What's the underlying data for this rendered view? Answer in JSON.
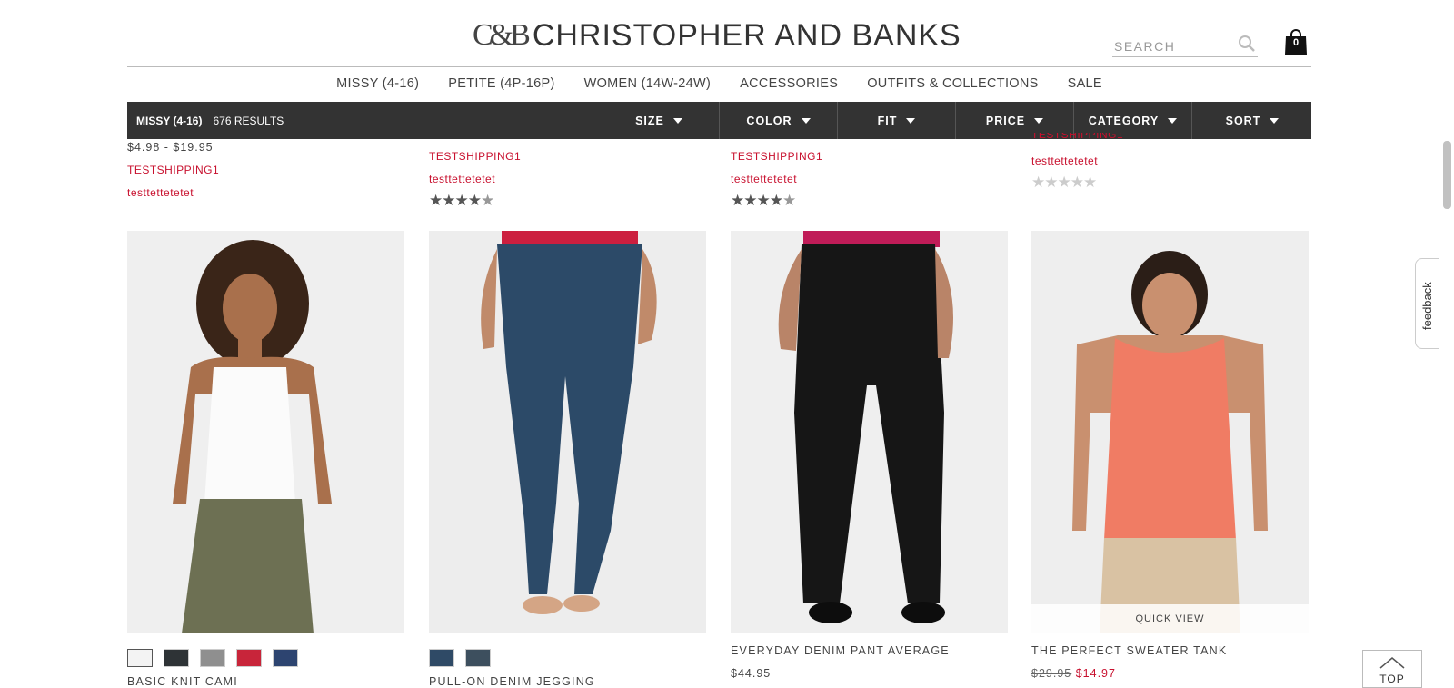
{
  "header": {
    "logo_mark": "C&B",
    "logo_text": "CHRISTOPHER AND BANKS",
    "search_placeholder": "SEARCH",
    "bag_count": "0"
  },
  "main_nav": [
    "MISSY (4-16)",
    "PETITE (4P-16P)",
    "WOMEN (14W-24W)",
    "ACCESSORIES",
    "OUTFITS & COLLECTIONS",
    "SALE"
  ],
  "filter_bar": {
    "category": "MISSY (4-16)",
    "results": "676 RESULTS",
    "filters": [
      "SIZE",
      "COLOR",
      "FIT",
      "PRICE",
      "CATEGORY",
      "SORT"
    ]
  },
  "top_row": [
    {
      "price": "$4.98 - $19.95",
      "promo": "TESTSHIPPING1",
      "promo2": "testtettetetet"
    },
    {
      "promo": "TESTSHIPPING1",
      "promo2": "testtettetetet",
      "rating": 4.5
    },
    {
      "promo": "TESTSHIPPING1",
      "promo2": "testtettetetet",
      "rating": 4.5
    },
    {
      "promo": "TESTSHIPPING1",
      "promo2": "testtettetetet",
      "rating": 0
    }
  ],
  "products": [
    {
      "name": "BASIC KNIT CAMI",
      "swatches": [
        "#f3f3f3",
        "#2e3336",
        "#8f8f8f",
        "#c8253a",
        "#2d4470"
      ]
    },
    {
      "name": "PULL-ON DENIM JEGGING",
      "swatches": [
        "#2f4a66",
        "#3d4f5e"
      ]
    },
    {
      "name": "EVERYDAY DENIM PANT AVERAGE",
      "price": "$44.95"
    },
    {
      "name": "THE PERFECT SWEATER TANK",
      "quick_view": "QUICK VIEW",
      "original_price": "$29.95",
      "sale_price": "$14.97"
    }
  ],
  "feedback_label": "feedback",
  "top_button": "TOP",
  "colors": {
    "filter_bar": "#333333",
    "accent_red": "#c8102e"
  }
}
